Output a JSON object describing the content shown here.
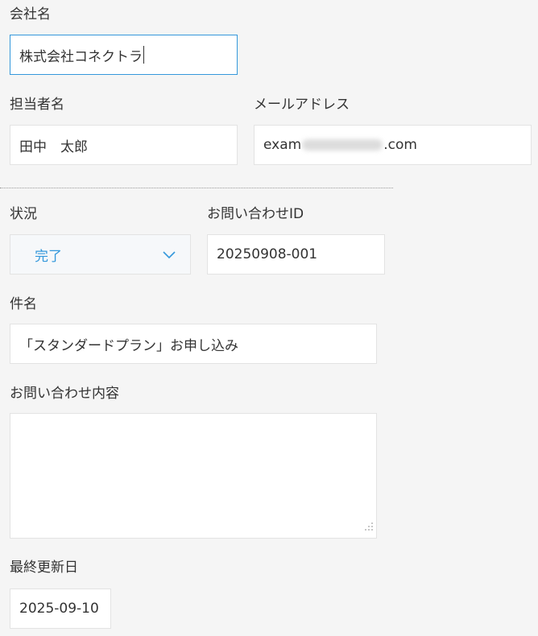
{
  "company": {
    "label": "会社名",
    "value": "株式会社コネクトラ"
  },
  "contact_person": {
    "label": "担当者名",
    "value": "田中　太郎"
  },
  "email": {
    "label": "メールアドレス",
    "value_prefix": "exam",
    "value_suffix": ".com"
  },
  "status": {
    "label": "状況",
    "selected": "完了"
  },
  "inquiry_id": {
    "label": "お問い合わせID",
    "value": "20250908-001"
  },
  "subject": {
    "label": "件名",
    "value": "「スタンダードプラン」お申し込み"
  },
  "content": {
    "label": "お問い合わせ内容",
    "value": ""
  },
  "last_updated": {
    "label": "最終更新日",
    "value": "2025-09-10"
  },
  "colors": {
    "accent": "#3498db",
    "focus_border": "#3498db",
    "background": "#f5f5f5"
  }
}
